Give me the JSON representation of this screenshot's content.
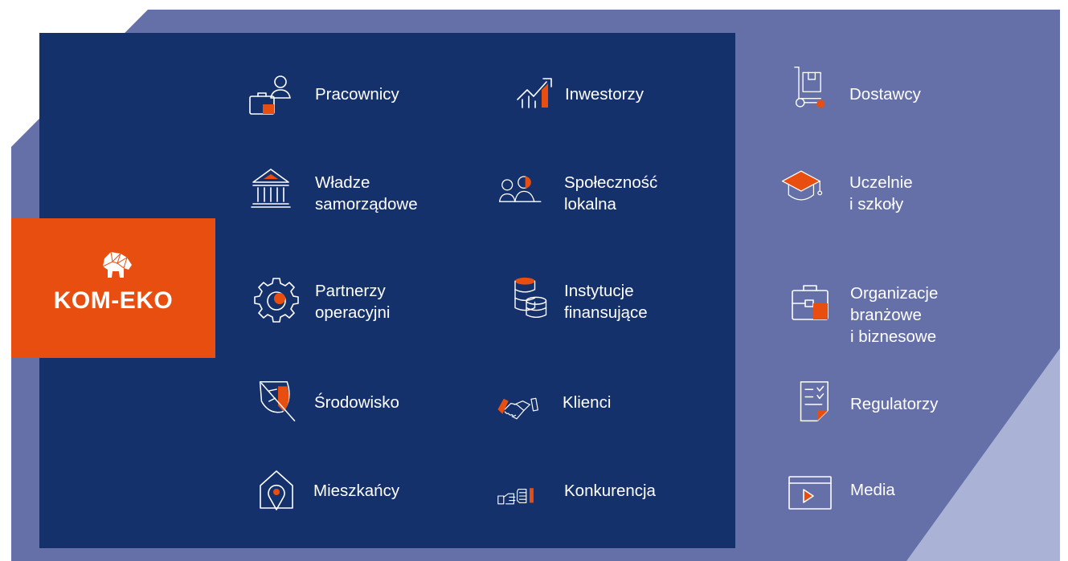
{
  "colors": {
    "inner_panel": "#15316b",
    "outer_panel": "#6570a8",
    "accent": "#e84e0f",
    "corner_light": "#aab2d6",
    "text": "#ffffff"
  },
  "logo": {
    "text": "KOM-EKO",
    "icon": "elephant-logo-icon"
  },
  "stakeholders": {
    "inner": [
      {
        "label": "Pracownicy",
        "icon": "employees-icon"
      },
      {
        "label": "Inwestorzy",
        "icon": "growth-chart-icon"
      },
      {
        "label": "Władze\nsamorządowe",
        "icon": "government-building-icon"
      },
      {
        "label": "Społeczność\nlokalna",
        "icon": "community-icon"
      },
      {
        "label": "Partnerzy\noperacyjni",
        "icon": "gear-icon"
      },
      {
        "label": "Instytucje\nfinansujące",
        "icon": "coin-stack-icon"
      },
      {
        "label": "Środowisko",
        "icon": "leaf-icon"
      },
      {
        "label": "Klienci",
        "icon": "handshake-icon"
      },
      {
        "label": "Mieszkańcy",
        "icon": "home-location-icon"
      },
      {
        "label": "Konkurencja",
        "icon": "fist-bump-icon"
      }
    ],
    "outer": [
      {
        "label": "Dostawcy",
        "icon": "hand-truck-icon"
      },
      {
        "label": "Uczelnie\ni szkoły",
        "icon": "graduation-cap-icon"
      },
      {
        "label": "Organizacje branżowe\ni biznesowe",
        "icon": "briefcase-icon"
      },
      {
        "label": "Regulatorzy",
        "icon": "checklist-document-icon"
      },
      {
        "label": "Media",
        "icon": "video-player-icon"
      }
    ]
  }
}
